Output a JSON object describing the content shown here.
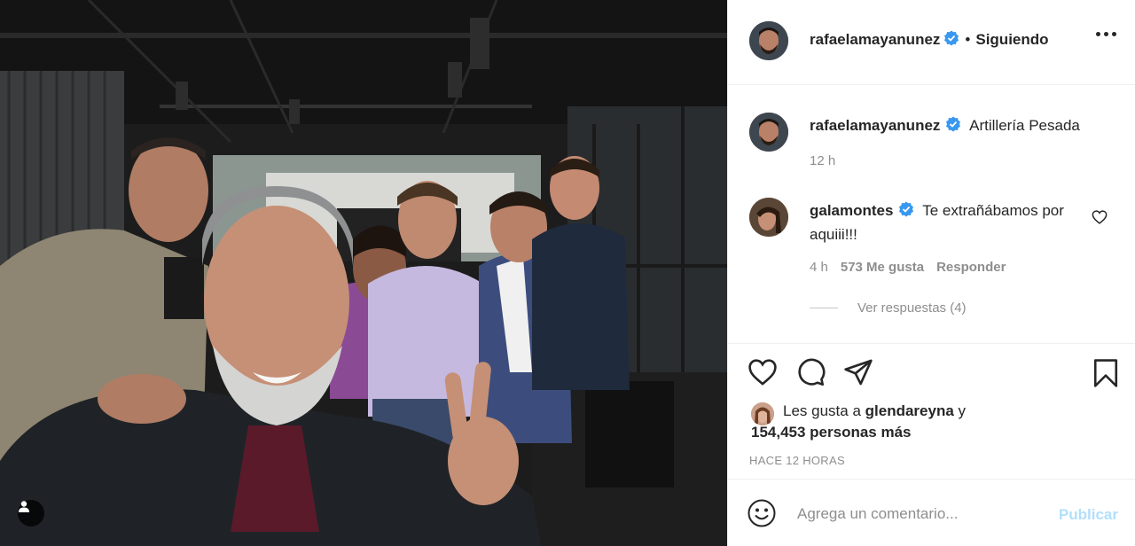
{
  "post": {
    "author": "rafaelamayanunez",
    "follow_dot": "•",
    "follow_label": "Siguiendo",
    "caption_author": "rafaelamayanunez",
    "caption_text": "Artillería Pesada",
    "caption_time": "12 h"
  },
  "comment": {
    "author": "galamontes",
    "text": "Te extrañábamos por aquiii!!!",
    "time": "4 h",
    "likes": "573 Me gusta",
    "reply": "Responder",
    "view_replies": "Ver respuestas (4)"
  },
  "likes": {
    "prefix": "Les gusta a",
    "user": "glendareyna",
    "and": "y",
    "count_text": "154,453 personas más"
  },
  "time_ago": "HACE 12 HORAS",
  "add_comment": {
    "placeholder": "Agrega un comentario...",
    "publish_label": "Publicar"
  },
  "colors": {
    "verified": "#3897f0",
    "publish_disabled": "#b2dffc",
    "muted": "#8e8e8e"
  },
  "icons": [
    "heart-icon",
    "comment-icon",
    "share-icon",
    "bookmark-icon",
    "more-icon",
    "emoji-icon",
    "user-tag-icon",
    "verified-icon"
  ]
}
